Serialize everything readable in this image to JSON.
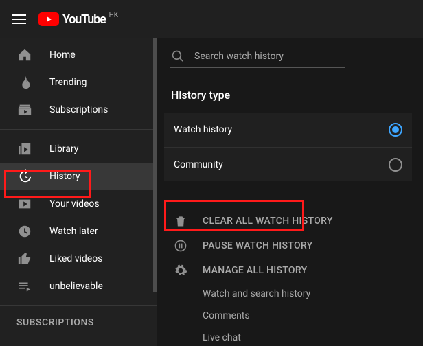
{
  "brand": {
    "name": "YouTube",
    "region": "HK"
  },
  "search": {
    "placeholder": "Search watch history"
  },
  "sidebar": {
    "items": [
      {
        "label": "Home"
      },
      {
        "label": "Trending"
      },
      {
        "label": "Subscriptions"
      },
      {
        "label": "Library"
      },
      {
        "label": "History"
      },
      {
        "label": "Your videos"
      },
      {
        "label": "Watch later"
      },
      {
        "label": "Liked videos"
      },
      {
        "label": "unbelievable"
      }
    ],
    "subs_heading": "SUBSCRIPTIONS"
  },
  "main": {
    "history_type_title": "History type",
    "types": [
      {
        "label": "Watch history",
        "checked": true
      },
      {
        "label": "Community",
        "checked": false
      }
    ],
    "actions": {
      "clear": "CLEAR ALL WATCH HISTORY",
      "pause": "PAUSE WATCH HISTORY",
      "manage": "MANAGE ALL HISTORY"
    },
    "sublinks": [
      "Watch and search history",
      "Comments",
      "Live chat"
    ]
  }
}
